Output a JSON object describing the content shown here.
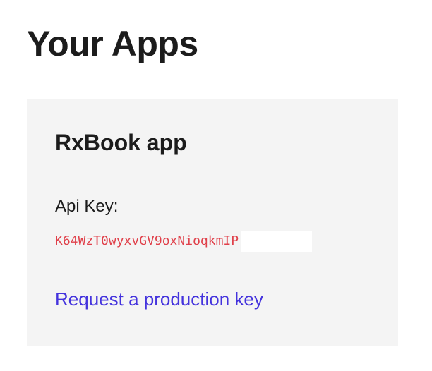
{
  "page": {
    "title": "Your Apps"
  },
  "app": {
    "name": "RxBook app",
    "api_key_label": "Api Key:",
    "api_key_value": "K64WzT0wyxvGV9oxNioqkmIP",
    "request_link_label": "Request a production key"
  },
  "colors": {
    "api_key": "#e0404a",
    "link": "#4433dd",
    "card_background": "#f4f4f4"
  }
}
